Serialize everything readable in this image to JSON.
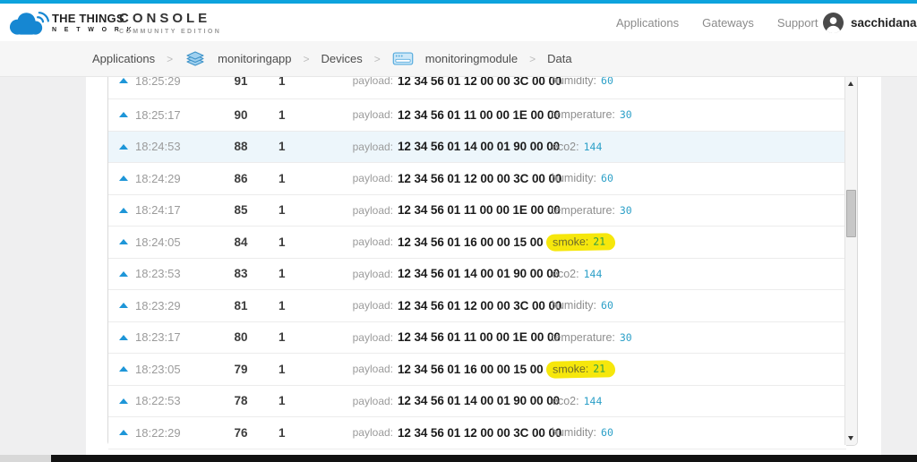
{
  "header": {
    "brand": {
      "line1": "THE THINGS",
      "line2": "N E T W O R K",
      "product": "CONSOLE",
      "edition": "COMMUNITY EDITION"
    },
    "nav": [
      {
        "label": "Applications"
      },
      {
        "label": "Gateways"
      },
      {
        "label": "Support"
      }
    ],
    "user": {
      "name": "sacchidanand_"
    }
  },
  "breadcrumb": {
    "separator": ">",
    "items": [
      {
        "label": "Applications"
      },
      {
        "label": "monitoringapp",
        "icon": "layers-icon"
      },
      {
        "label": "Devices"
      },
      {
        "label": "monitoringmodule",
        "icon": "device-icon"
      },
      {
        "label": "Data"
      }
    ]
  },
  "table": {
    "payload_label": "payload:",
    "rows": [
      {
        "time": "18:25:29",
        "counter": "91",
        "port": "1",
        "payload": "12 34 56 01 12 00 00 3C 00 00",
        "field": "humidity:",
        "value": "60",
        "clipped": true
      },
      {
        "time": "18:25:17",
        "counter": "90",
        "port": "1",
        "payload": "12 34 56 01 11 00 00 1E 00 00",
        "field": "temperature:",
        "value": "30"
      },
      {
        "time": "18:24:53",
        "counter": "88",
        "port": "1",
        "payload": "12 34 56 01 14 00 01 90 00 00",
        "field": "eco2:",
        "value": "144",
        "row_highlight": true
      },
      {
        "time": "18:24:29",
        "counter": "86",
        "port": "1",
        "payload": "12 34 56 01 12 00 00 3C 00 00",
        "field": "humidity:",
        "value": "60"
      },
      {
        "time": "18:24:17",
        "counter": "85",
        "port": "1",
        "payload": "12 34 56 01 11 00 00 1E 00 00",
        "field": "temperature:",
        "value": "30"
      },
      {
        "time": "18:24:05",
        "counter": "84",
        "port": "1",
        "payload": "12 34 56 01 16 00 00 15 00 00",
        "field": "smoke:",
        "value": "21",
        "marked": true
      },
      {
        "time": "18:23:53",
        "counter": "83",
        "port": "1",
        "payload": "12 34 56 01 14 00 01 90 00 00",
        "field": "eco2:",
        "value": "144"
      },
      {
        "time": "18:23:29",
        "counter": "81",
        "port": "1",
        "payload": "12 34 56 01 12 00 00 3C 00 00",
        "field": "humidity:",
        "value": "60"
      },
      {
        "time": "18:23:17",
        "counter": "80",
        "port": "1",
        "payload": "12 34 56 01 11 00 00 1E 00 00",
        "field": "temperature:",
        "value": "30"
      },
      {
        "time": "18:23:05",
        "counter": "79",
        "port": "1",
        "payload": "12 34 56 01 16 00 00 15 00 00",
        "field": "smoke:",
        "value": "21",
        "marked": true
      },
      {
        "time": "18:22:53",
        "counter": "78",
        "port": "1",
        "payload": "12 34 56 01 14 00 01 90 00 00",
        "field": "eco2:",
        "value": "144"
      },
      {
        "time": "18:22:29",
        "counter": "76",
        "port": "1",
        "payload": "12 34 56 01 12 00 00 3C 00 00",
        "field": "humidity:",
        "value": "60"
      }
    ]
  },
  "colors": {
    "accent_blue": "#0da3dd",
    "logo_blue": "#1687d2",
    "uplink_arrow_blue": "#1e96d8",
    "value_teal": "#2da0c8",
    "highlight_yellow": "#f6e70c",
    "row_highlight_blue": "#edf6fb"
  }
}
